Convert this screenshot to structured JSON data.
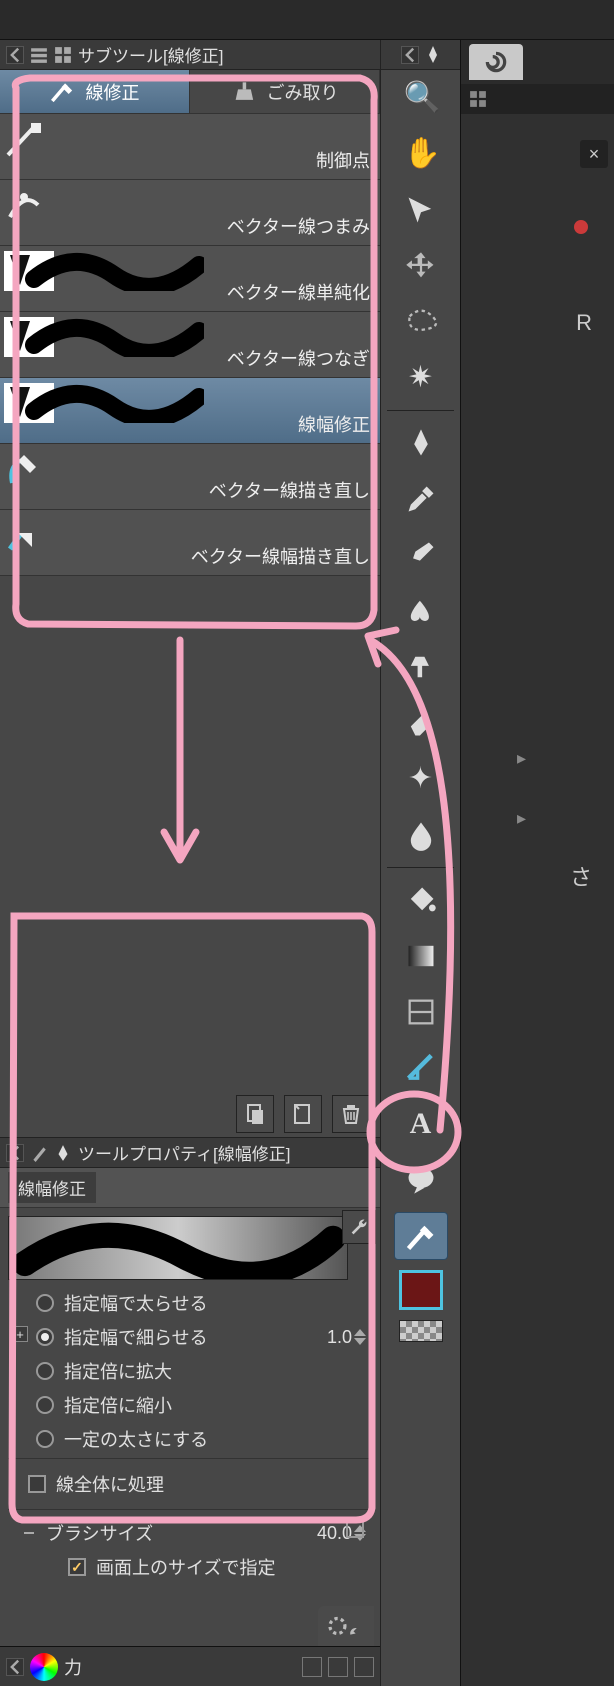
{
  "subtool_panel": {
    "title": "サブツール[線修正]",
    "tabs": [
      {
        "label": "線修正",
        "active": true
      },
      {
        "label": "ごみ取り",
        "active": false
      }
    ],
    "items": [
      {
        "label": "制御点",
        "selected": false,
        "has_stroke": false
      },
      {
        "label": "ベクター線つまみ",
        "selected": false,
        "has_stroke": false
      },
      {
        "label": "ベクター線単純化",
        "selected": false,
        "has_stroke": true
      },
      {
        "label": "ベクター線つなぎ",
        "selected": false,
        "has_stroke": true
      },
      {
        "label": "線幅修正",
        "selected": true,
        "has_stroke": true
      },
      {
        "label": "ベクター線描き直し",
        "selected": false,
        "has_stroke": false
      },
      {
        "label": "ベクター線幅描き直し",
        "selected": false,
        "has_stroke": false
      }
    ]
  },
  "tool_property": {
    "title": "ツールプロパティ[線幅修正]",
    "subtitle": "線幅修正",
    "width_value": "1.0",
    "modes": [
      {
        "label": "指定幅で太らせる",
        "checked": false
      },
      {
        "label": "指定幅で細らせる",
        "checked": true
      },
      {
        "label": "指定倍に拡大",
        "checked": false
      },
      {
        "label": "指定倍に縮小",
        "checked": false
      },
      {
        "label": "一定の太さにする",
        "checked": false
      }
    ],
    "whole_line": {
      "label": "線全体に処理",
      "checked": false
    },
    "brush_size": {
      "label": "ブラシサイズ",
      "value": "40.0"
    },
    "screen_size": {
      "label": "画面上のサイズで指定",
      "checked": true
    }
  },
  "bottom_strip": {
    "label": "力"
  },
  "toolbar_icons": [
    "magnifier-icon",
    "hand-icon",
    "rotate-icon",
    "move-icon",
    "lasso-icon",
    "wand-icon",
    "pen-icon",
    "dropper-icon",
    "brush-icon",
    "paint-icon",
    "airbrush-icon",
    "eraser-icon",
    "decoration-icon",
    "blend-icon",
    "fill-icon",
    "gradient-icon",
    "frame-icon",
    "ruler-icon",
    "text-icon",
    "balloon-icon",
    "line-correct-icon"
  ],
  "color_chip": "#6b1616",
  "right_panel": {
    "close": "×",
    "letter1": "R",
    "letter2": "さ"
  }
}
